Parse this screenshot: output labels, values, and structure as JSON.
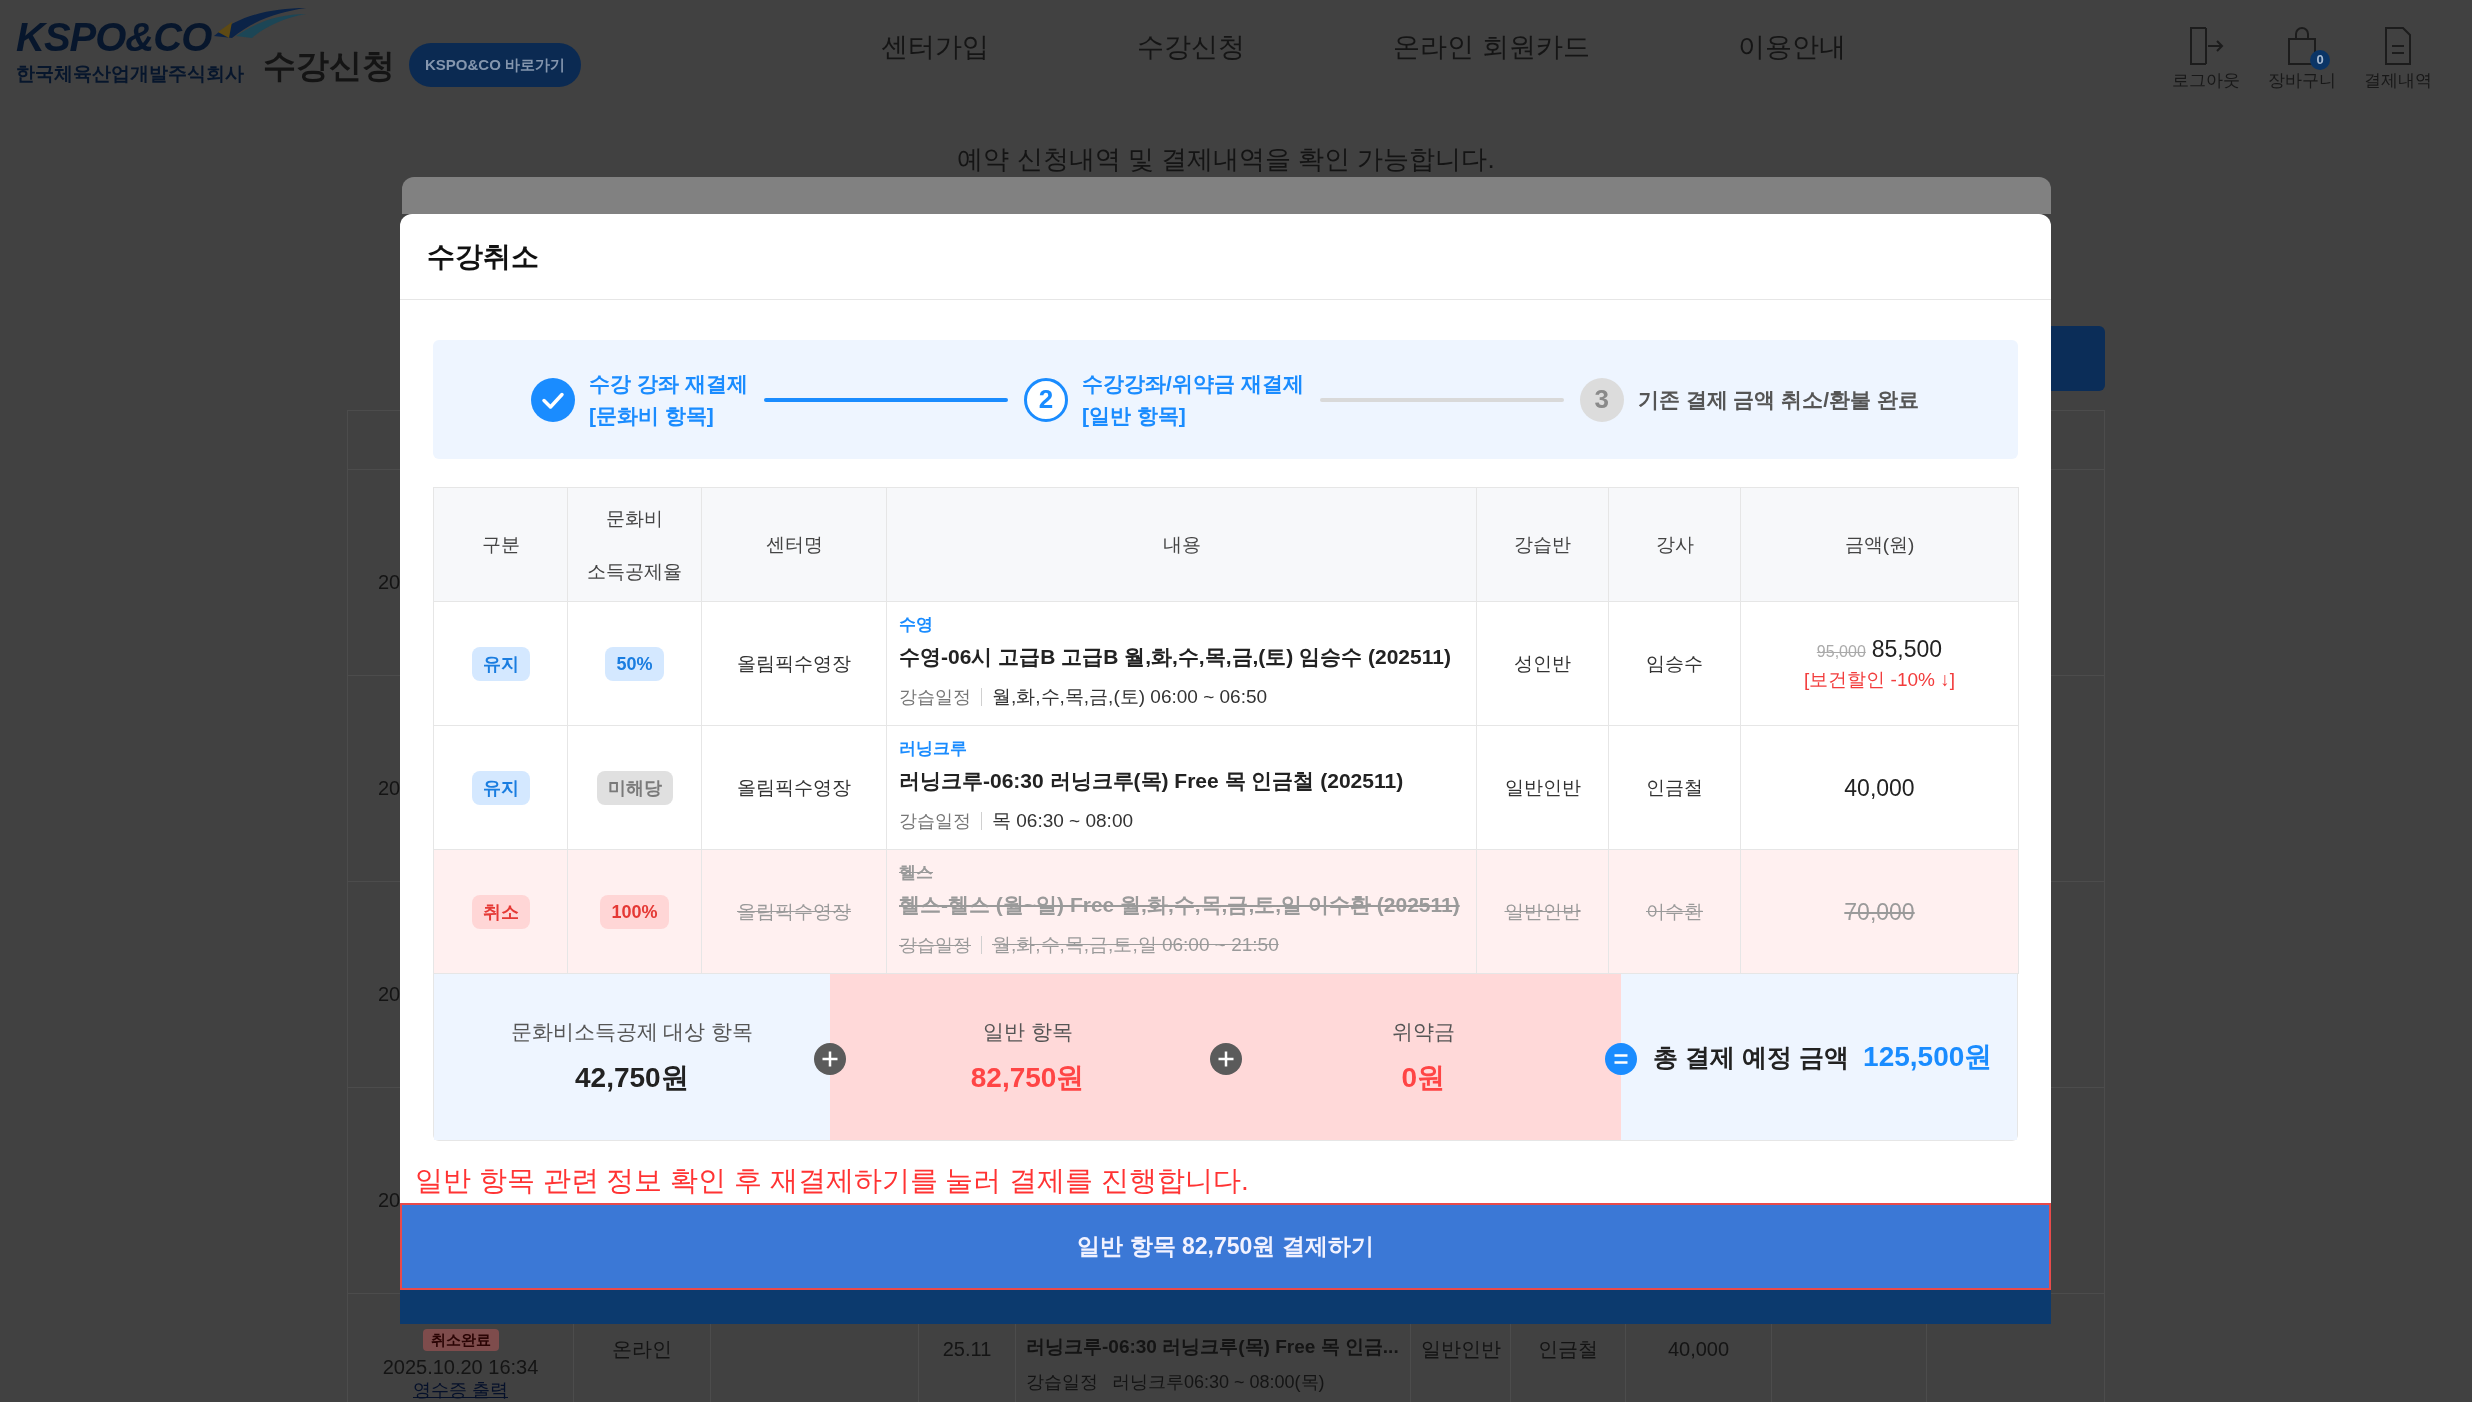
{
  "header": {
    "logo": {
      "wordmark": "KSPO&CO",
      "company": "한국체육산업개발주식회사"
    },
    "site_title": "수강신청",
    "shortcut_button": "KSPO&CO 바로가기",
    "nav": [
      {
        "label": "센터가입"
      },
      {
        "label": "수강신청"
      },
      {
        "label": "온라인 회원카드"
      },
      {
        "label": "이용안내"
      }
    ],
    "utilities": [
      {
        "kind": "logout",
        "label": "로그아웃"
      },
      {
        "kind": "cart",
        "label": "장바구니",
        "count": "0"
      },
      {
        "kind": "receipt",
        "label": "결제내역"
      }
    ]
  },
  "page": {
    "subtitle": "예약 신청내역 및 결제내역을 확인 가능합니다.",
    "history_rows": [
      {
        "date": "20"
      },
      {
        "date": "20"
      },
      {
        "date": "20"
      },
      {
        "date": "20"
      },
      {
        "status": "취소완료",
        "date": "2025.10.20 16:34",
        "receipt_link": "영수증 출력",
        "channel": "온라인",
        "month": "25.11",
        "course": "러닝크루-06:30 러닝크루(목) Free 목 인금...",
        "schedule_label": "강습일정",
        "schedule": "러닝크루06:30 ~ 08:00(목)",
        "class": "일반인반",
        "instructor": "인금철",
        "amount": "40,000"
      }
    ]
  },
  "modal": {
    "title": "수강취소",
    "steps": [
      {
        "title": "수강 강좌 재결제",
        "subtitle": "[문화비 항목]",
        "completed": true,
        "current": false
      },
      {
        "number": "2",
        "title": "수강강좌/위약금 재결제",
        "subtitle": "[일반 항목]",
        "completed": false,
        "current": true
      },
      {
        "number": "3",
        "title": "기존 결제 금액 취소/환불 완료",
        "completed": false,
        "current": false
      }
    ],
    "table": {
      "columns": [
        {
          "label": "구분"
        },
        {
          "label": "문화비 소득공제율"
        },
        {
          "label": "센터명"
        },
        {
          "label": "내용"
        },
        {
          "label": "강습반"
        },
        {
          "label": "강사"
        },
        {
          "label": "금액(원)"
        }
      ],
      "rows": [
        {
          "status": "유지",
          "rate": "50%",
          "rate_applies": true,
          "center": "올림픽수영장",
          "category": "수영",
          "course": "수영-06시 고급B 고급B 월,화,수,목,금,(토) 임승수 (202511)",
          "schedule_label": "강습일정",
          "schedule": "월,화,수,목,금,(토) 06:00 ~ 06:50",
          "class": "성인반",
          "instructor": "임승수",
          "original_price": "95,000",
          "price": "85,500",
          "discount_note": "[보건할인 -10% ↓]",
          "cancelled": false
        },
        {
          "status": "유지",
          "rate": "미해당",
          "rate_applies": false,
          "center": "올림픽수영장",
          "category": "러닝크루",
          "course": "러닝크루-06:30 러닝크루(목) Free 목 인금철 (202511)",
          "schedule_label": "강습일정",
          "schedule": "목 06:30 ~ 08:00",
          "class": "일반인반",
          "instructor": "인금철",
          "price": "40,000",
          "cancelled": false
        },
        {
          "status": "취소",
          "rate": "100%",
          "rate_applies": true,
          "center": "올림픽수영장",
          "category": "헬스",
          "course": "헬스-헬스 (월~일) Free 월,화,수,목,금,토,일 이수환 (202511)",
          "schedule_label": "강습일정",
          "schedule": "월,화,수,목,금,토,일 06:00 ~ 21:50",
          "class": "일반인반",
          "instructor": "이수환",
          "price": "70,000",
          "cancelled": true
        }
      ]
    },
    "summary": {
      "items": [
        {
          "label": "문화비소득공제 대상 항목",
          "value": "42,750원",
          "highlighted": false
        },
        {
          "label": "일반 항목",
          "value": "82,750원",
          "highlighted": true
        },
        {
          "label": "위약금",
          "value": "0원",
          "highlighted": true
        }
      ],
      "total": {
        "label": "총 결제 예정 금액",
        "value": "125,500원"
      }
    },
    "notice": "일반 항목 관련 정보 확인 후 재결제하기를 눌러 결제를 진행합니다.",
    "pay_button": "일반 항목 82,750원 결제하기"
  }
}
